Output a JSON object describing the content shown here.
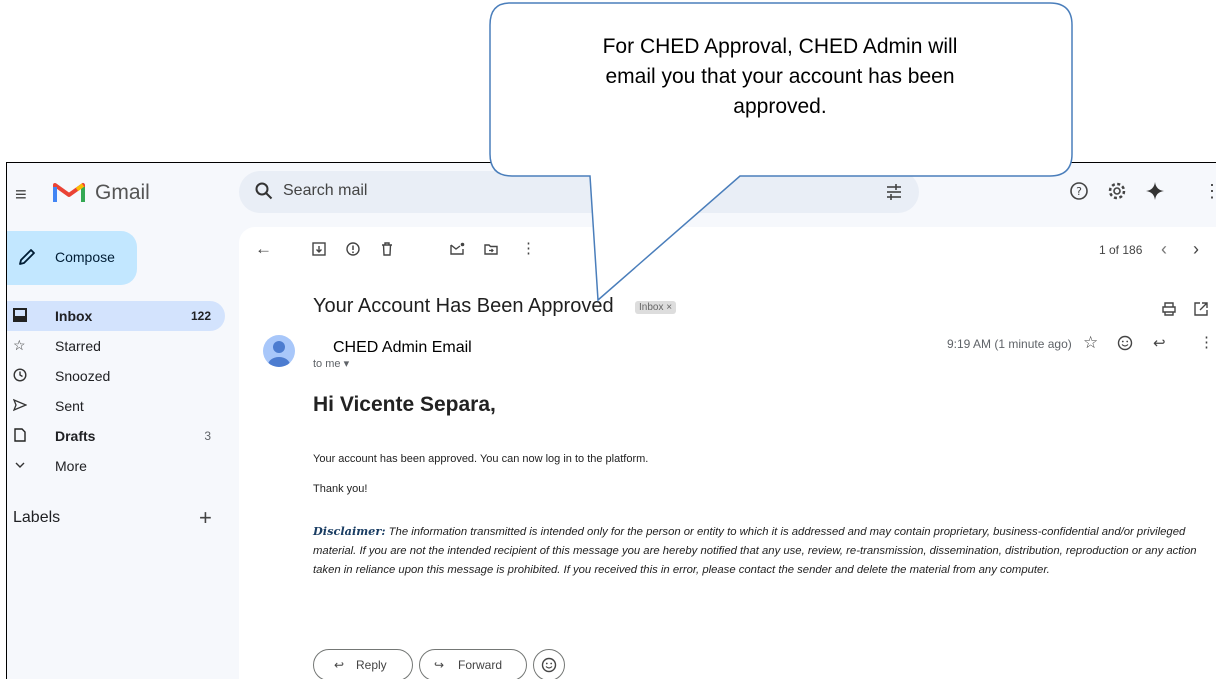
{
  "callout": {
    "line1": "For CHED Approval, CHED Admin will",
    "line2": "email you that your account has been",
    "line3": "approved."
  },
  "app": {
    "name": "Gmail"
  },
  "search": {
    "placeholder": "Search mail"
  },
  "sidebar": {
    "compose": "Compose",
    "items": [
      {
        "label": "Inbox",
        "count": "122",
        "icon": "inbox-icon"
      },
      {
        "label": "Starred",
        "count": "",
        "icon": "star-icon"
      },
      {
        "label": "Snoozed",
        "count": "",
        "icon": "clock-icon"
      },
      {
        "label": "Sent",
        "count": "",
        "icon": "send-icon"
      },
      {
        "label": "Drafts",
        "count": "3",
        "icon": "draft-icon"
      },
      {
        "label": "More",
        "count": "",
        "icon": "chevron-down-icon"
      }
    ],
    "labels_heading": "Labels"
  },
  "toolbar": {
    "pager": "1 of 186"
  },
  "email": {
    "subject": "Your Account Has Been Approved",
    "label_chip": "Inbox ×",
    "sender": "CHED Admin Email",
    "to": "to me ▾",
    "time": "9:19 AM (1 minute ago)",
    "greeting": "Hi Vicente Separa,",
    "body": "Your account has been approved. You can now log in to the platform.",
    "thanks": "Thank you!",
    "disclaimer_label": "Disclaimer:",
    "disclaimer_text": " The information transmitted is intended only for the person or entity to which it is addressed and may contain proprietary, business-confidential and/or privileged material. If you are not the intended recipient of this message you are hereby notified that any use, review, re-transmission, dissemination, distribution, reproduction or any action taken in reliance upon this message is prohibited. If you received this in error, please contact the sender and delete the material from any computer."
  },
  "actions": {
    "reply": "Reply",
    "forward": "Forward"
  },
  "colors": {
    "compose_bg": "#c2e7ff",
    "active_nav": "#d3e3fd",
    "callout_border": "#4a7ebb"
  }
}
